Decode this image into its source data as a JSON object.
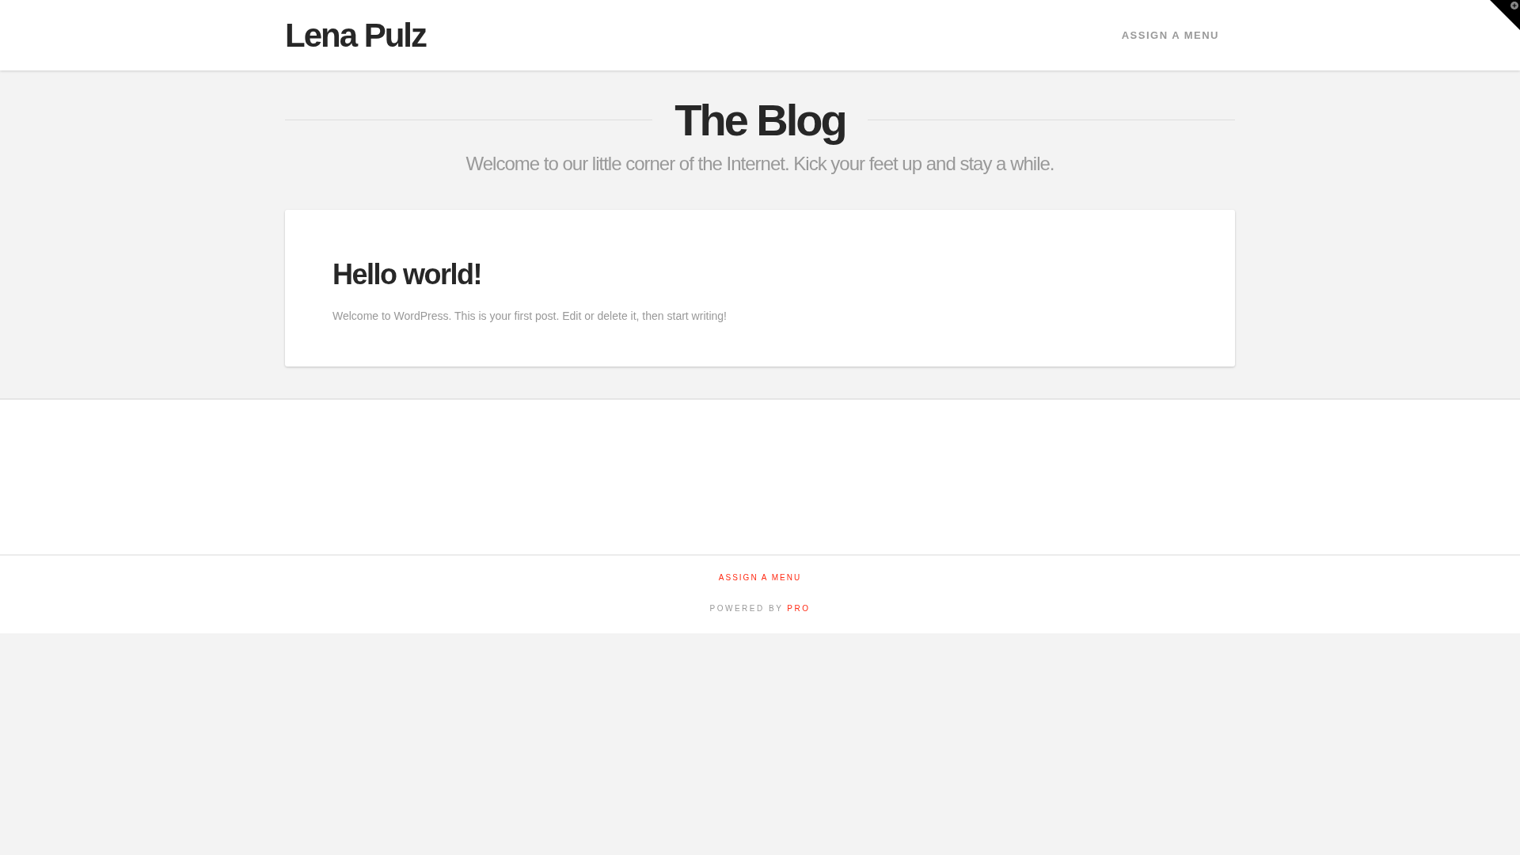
{
  "header": {
    "site_title": "Lena Pulz",
    "menu_link": "ASSIGN A MENU"
  },
  "landmarks": {
    "title": "The Blog",
    "subtitle": "Welcome to our little corner of the Internet. Kick your feet up and stay a while."
  },
  "posts": [
    {
      "title": "Hello world!",
      "excerpt": "Welcome to WordPress. This is your first post. Edit or delete it, then start writing!"
    }
  ],
  "footer": {
    "menu_link": "ASSIGN A MENU",
    "powered_by": "POWERED BY",
    "powered_by_link": "PRO"
  }
}
